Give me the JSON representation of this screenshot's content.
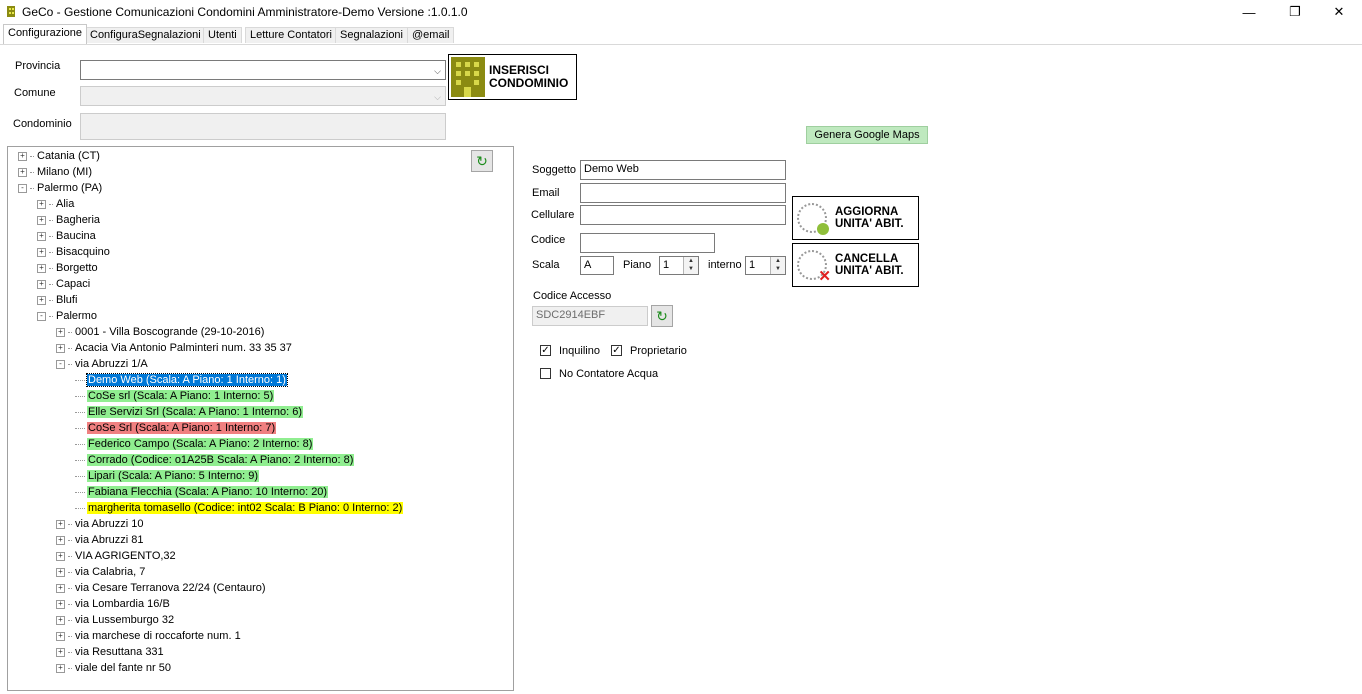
{
  "window": {
    "title": "GeCo - Gestione Comunicazioni Condomini Amministratore-Demo  Versione :1.0.1.0",
    "minimize": "—",
    "restore": "❐",
    "close": "✕"
  },
  "tabs": [
    "Configurazione",
    "ConfiguraSegnalazioni",
    "Utenti",
    "Letture Contatori",
    "Segnalazioni",
    "@email"
  ],
  "form": {
    "provincia_label": "Provincia",
    "comune_label": "Comune",
    "condominio_label": "Condominio",
    "inserisci_line1": "INSERISCI",
    "inserisci_line2": "CONDOMINIO",
    "genera_maps": "Genera Google Maps"
  },
  "tree": [
    {
      "label": "Catania (CT)",
      "sym": "+"
    },
    {
      "label": "Milano (MI)",
      "sym": "+"
    },
    {
      "label": "Palermo (PA)",
      "sym": "-"
    },
    {
      "label": "Alia",
      "sym": "+"
    },
    {
      "label": "Bagheria",
      "sym": "+"
    },
    {
      "label": "Baucina",
      "sym": "+"
    },
    {
      "label": "Bisacquino",
      "sym": "+"
    },
    {
      "label": "Borgetto",
      "sym": "+"
    },
    {
      "label": "Capaci",
      "sym": "+"
    },
    {
      "label": "Blufi",
      "sym": "+"
    },
    {
      "label": "Palermo",
      "sym": "-"
    },
    {
      "label": "0001 - Villa Boscogrande (29-10-2016)",
      "sym": "+"
    },
    {
      "label": "Acacia Via Antonio Palminteri num. 33 35 37",
      "sym": "+"
    },
    {
      "label": "via Abruzzi 1/A",
      "sym": "-"
    },
    {
      "label": "Demo Web (Scala: A Piano: 1 Interno: 1)",
      "sym": ""
    },
    {
      "label": "CoSe srl (Scala: A Piano: 1 Interno: 5)",
      "sym": ""
    },
    {
      "label": "Elle Servizi Srl (Scala: A Piano: 1 Interno: 6)",
      "sym": ""
    },
    {
      "label": "CoSe Srl (Scala: A Piano: 1 Interno: 7)",
      "sym": ""
    },
    {
      "label": "Federico Campo (Scala: A Piano: 2 Interno: 8)",
      "sym": ""
    },
    {
      "label": "Corrado (Codice: o1A25B Scala: A Piano: 2 Interno: 8)",
      "sym": ""
    },
    {
      "label": "Lipari (Scala: A Piano: 5 Interno: 9)",
      "sym": ""
    },
    {
      "label": "Fabiana Flecchia (Scala: A Piano: 10 Interno: 20)",
      "sym": ""
    },
    {
      "label": "margherita tomasello  (Codice: int02 Scala: B Piano: 0 Interno: 2)",
      "sym": ""
    },
    {
      "label": "via Abruzzi 10",
      "sym": "+"
    },
    {
      "label": "via Abruzzi 81",
      "sym": "+"
    },
    {
      "label": "VIA AGRIGENTO,32",
      "sym": "+"
    },
    {
      "label": "via Calabria, 7",
      "sym": "+"
    },
    {
      "label": "via Cesare Terranova 22/24 (Centauro)",
      "sym": "+"
    },
    {
      "label": "via Lombardia 16/B",
      "sym": "+"
    },
    {
      "label": "via Lussemburgo 32",
      "sym": "+"
    },
    {
      "label": "via marchese di roccaforte num. 1",
      "sym": "+"
    },
    {
      "label": "via Resuttana 331",
      "sym": "+"
    },
    {
      "label": "viale del fante nr 50",
      "sym": "+"
    }
  ],
  "tree_colors": {
    "selected": "#0078d7",
    "green": "#90ee90",
    "red": "#f08080",
    "yellow": "#ffff00"
  },
  "detail": {
    "soggetto_label": "Soggetto",
    "soggetto_value": "Demo Web",
    "email_label": "Email",
    "cellulare_label": "Cellulare",
    "codice_label": "Codice",
    "scala_label": "Scala",
    "scala_value": "A",
    "piano_label": "Piano",
    "piano_value": "1",
    "interno_label": "interno",
    "interno_value": "1",
    "codice_accesso_label": "Codice Accesso",
    "codice_accesso_value": "SDC2914EBF",
    "aggiorna_line1": "AGGIORNA",
    "aggiorna_line2": "UNITA' ABIT.",
    "cancella_line1": "CANCELLA",
    "cancella_line2": "UNITA' ABIT.",
    "inquilino_label": "Inquilino",
    "proprietario_label": "Proprietario",
    "no_contatore_label": "No Contatore Acqua"
  }
}
